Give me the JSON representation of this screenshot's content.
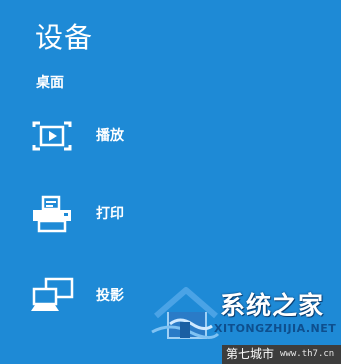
{
  "charm": {
    "title": "设备",
    "section_label": "桌面"
  },
  "devices": [
    {
      "label": "播放",
      "icon": "play-to-icon"
    },
    {
      "label": "打印",
      "icon": "printer-icon"
    },
    {
      "label": "投影",
      "icon": "project-icon"
    }
  ],
  "watermark": {
    "brand": "系统之家",
    "url": "XITONGZHIJIA.NET"
  },
  "footer": {
    "left": "第七城市",
    "right": "www.th7.cn"
  },
  "colors": {
    "background": "#1e8ad6",
    "text": "#ffffff"
  }
}
